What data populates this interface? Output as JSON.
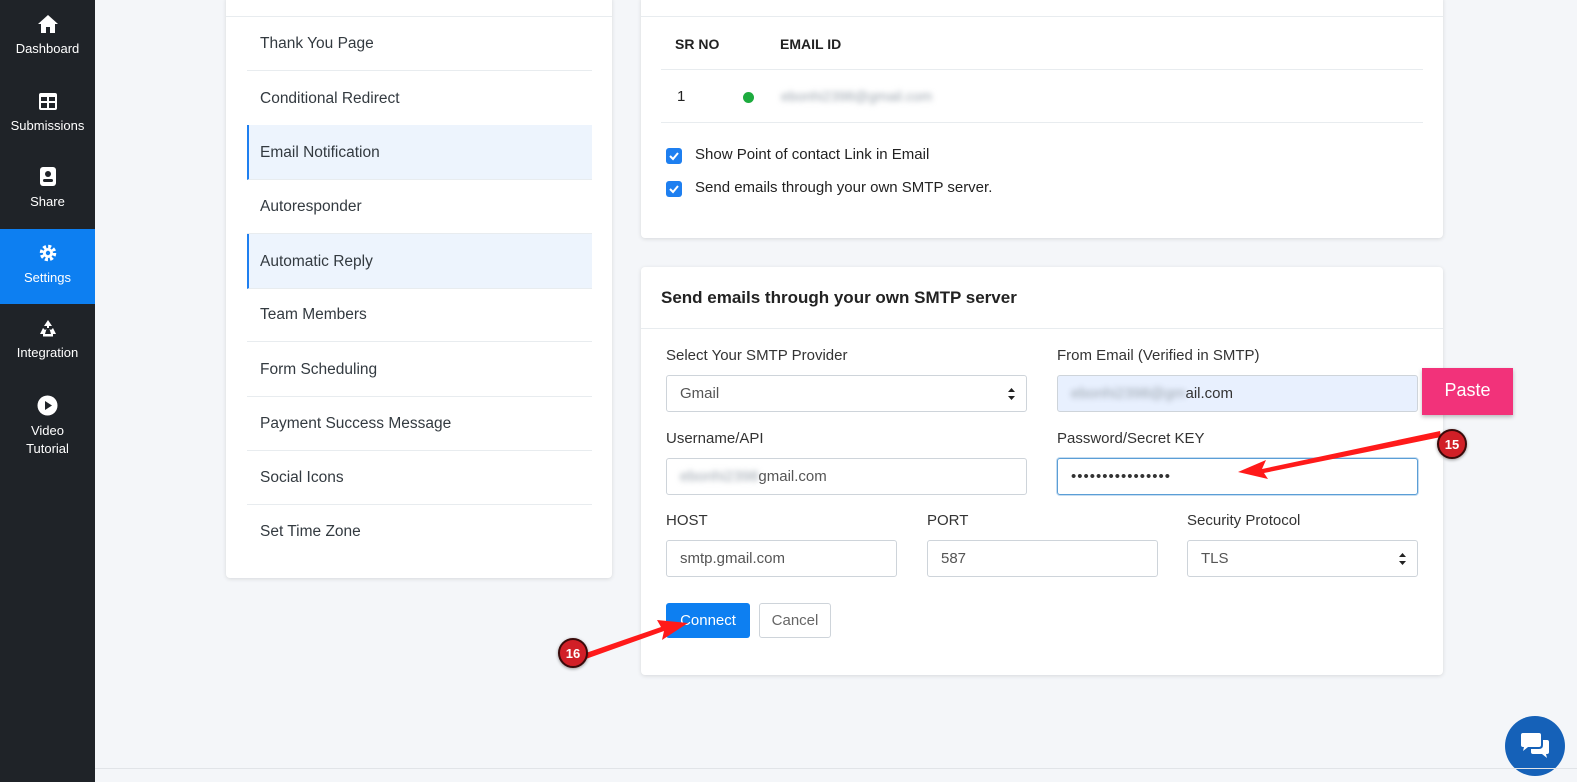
{
  "nav": {
    "items": [
      {
        "label": "Dashboard",
        "icon": "home-icon"
      },
      {
        "label": "Submissions",
        "icon": "table-icon"
      },
      {
        "label": "Share",
        "icon": "share-icon"
      },
      {
        "label": "Settings",
        "icon": "gear-icon"
      },
      {
        "label": "Integration",
        "icon": "integration-icon"
      },
      {
        "label": "Video Tutorial",
        "icon": "play-icon"
      }
    ]
  },
  "settings_menu": {
    "items": [
      "Thank You Page",
      "Conditional Redirect",
      "Email Notification",
      "Autoresponder",
      "Automatic Reply",
      "Team Members",
      "Form Scheduling",
      "Payment Success Message",
      "Social Icons",
      "Set Time Zone"
    ]
  },
  "emails_table": {
    "headers": [
      "SR NO",
      "EMAIL ID"
    ],
    "rows": [
      {
        "sr": "1",
        "status_color": "#1dab3e",
        "email": "ebonhi2398@gmail.com"
      }
    ]
  },
  "options": {
    "point_of_contact": "Show Point of contact Link in Email",
    "own_smtp": "Send emails through your own SMTP server."
  },
  "smtp": {
    "title": "Send emails through your own SMTP server",
    "provider_label": "Select Your SMTP Provider",
    "provider_value": "Gmail",
    "from_email_label": "From Email (Verified in SMTP)",
    "from_email_blurred": "ebonhi2398@gm",
    "from_email_visible": "ail.com",
    "username_label": "Username/API",
    "username_blurred": "ebonhi2398",
    "username_visible": "gmail.com",
    "password_label": "Password/Secret KEY",
    "password_value": "••••••••••••••••",
    "host_label": "HOST",
    "host_value": "smtp.gmail.com",
    "port_label": "PORT",
    "port_value": "587",
    "protocol_label": "Security Protocol",
    "protocol_value": "TLS",
    "connect_label": "Connect",
    "cancel_label": "Cancel"
  },
  "annotations": {
    "paste_label": "Paste",
    "step_15": "15",
    "step_16": "16",
    "arrow_color": "#ff1a1a"
  },
  "colors": {
    "nav_bg": "#1f2328",
    "accent": "#0d7ff1",
    "paste": "#f2327a"
  }
}
